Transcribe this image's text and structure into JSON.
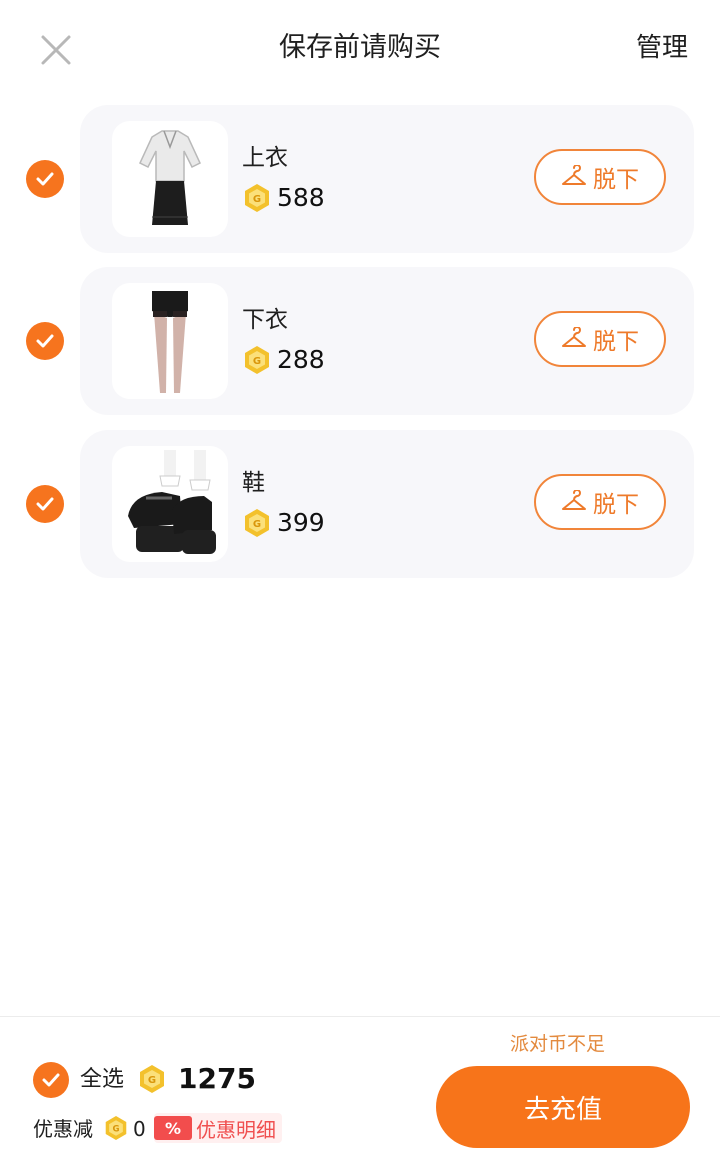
{
  "header": {
    "title": "保存前请购买",
    "manage_label": "管理",
    "close_icon": "close-icon"
  },
  "items": [
    {
      "name": "上衣",
      "price": "588",
      "action_label": "脱下",
      "checked": true,
      "thumb_icon": "blouse-skirt-outfit"
    },
    {
      "name": "下衣",
      "price": "288",
      "action_label": "脱下",
      "checked": true,
      "thumb_icon": "shorts-stockings"
    },
    {
      "name": "鞋",
      "price": "399",
      "action_label": "脱下",
      "checked": true,
      "thumb_icon": "platform-mary-jane-shoes"
    }
  ],
  "footer": {
    "select_all_label": "全选",
    "total": "1275",
    "discount_label": "优惠减",
    "discount_value": "0",
    "discount_badge": "%",
    "discount_detail_label": "优惠明细",
    "insufficient_text": "派对币不足",
    "recharge_label": "去充值"
  },
  "colors": {
    "accent": "#f6741e",
    "card_bg": "#f7f7fa",
    "coin": "#f3c12c",
    "discount_red": "#f24d4d"
  }
}
